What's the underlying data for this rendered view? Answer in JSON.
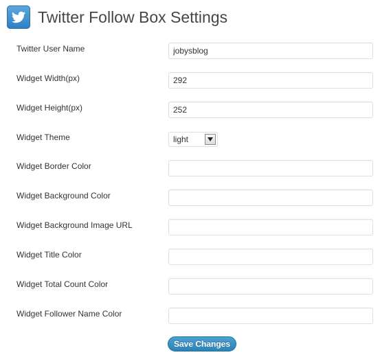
{
  "header": {
    "title": "Twitter Follow Box Settings",
    "logo_icon": "twitter-bird-icon"
  },
  "fields": {
    "user_name": {
      "label": "Twitter User Name",
      "value": "jobysblog"
    },
    "width": {
      "label": "Widget Width(px)",
      "value": "292"
    },
    "height": {
      "label": "Widget Height(px)",
      "value": "252"
    },
    "theme": {
      "label": "Widget Theme",
      "value": "light"
    },
    "border_color": {
      "label": "Widget Border Color",
      "value": ""
    },
    "background_color": {
      "label": "Widget Background Color",
      "value": ""
    },
    "background_image_url": {
      "label": "Widget Background Image URL",
      "value": ""
    },
    "title_color": {
      "label": "Widget Title Color",
      "value": ""
    },
    "total_count_color": {
      "label": "Widget Total Count Color",
      "value": ""
    },
    "follower_name_color": {
      "label": "Widget Follower Name Color",
      "value": ""
    }
  },
  "actions": {
    "save_label": "Save Changes"
  },
  "colors": {
    "button_blue": "#2e81b5",
    "logo_blue": "#3d8fd0",
    "input_border": "#dfdfdf"
  }
}
